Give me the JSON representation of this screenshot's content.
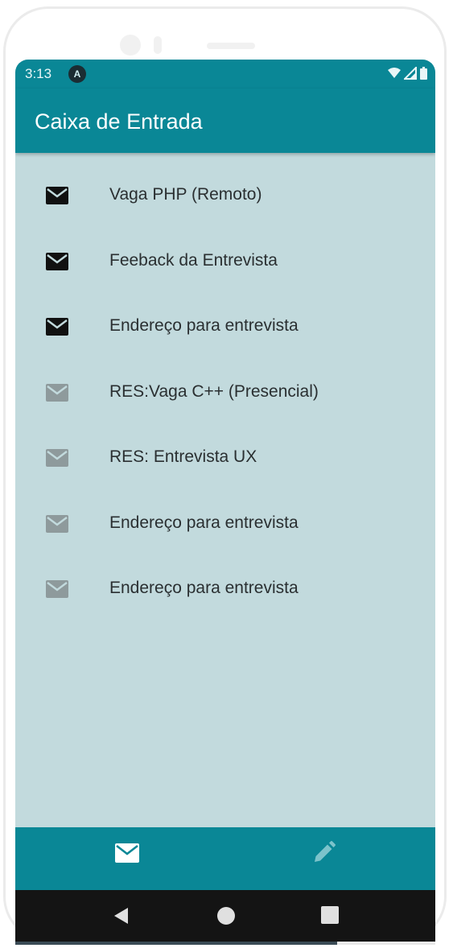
{
  "status_bar": {
    "time": "3:13",
    "notification_badge": "A",
    "icons": [
      "wifi-icon",
      "signal-icon",
      "battery-icon"
    ]
  },
  "app_bar": {
    "title": "Caixa de Entrada"
  },
  "messages": [
    {
      "subject": "Vaga PHP (Remoto)",
      "unread": true
    },
    {
      "subject": "Feeback da Entrevista",
      "unread": true
    },
    {
      "subject": "Endereço para entrevista",
      "unread": true
    },
    {
      "subject": "RES:Vaga C++ (Presencial)",
      "unread": false
    },
    {
      "subject": "RES: Entrevista UX",
      "unread": false
    },
    {
      "subject": "Endereço para entrevista",
      "unread": false
    },
    {
      "subject": "Endereço para entrevista",
      "unread": false
    }
  ],
  "bottom_nav": {
    "tabs": [
      {
        "icon": "mail-icon",
        "active": true
      },
      {
        "icon": "pencil-icon",
        "active": false
      }
    ]
  },
  "system_nav": {
    "buttons": [
      "back-icon",
      "home-icon",
      "recents-icon"
    ]
  },
  "colors": {
    "primary": "#0a8796",
    "background": "#c2dadd",
    "unread_icon": "#111111",
    "read_icon": "#8e9a9c"
  }
}
